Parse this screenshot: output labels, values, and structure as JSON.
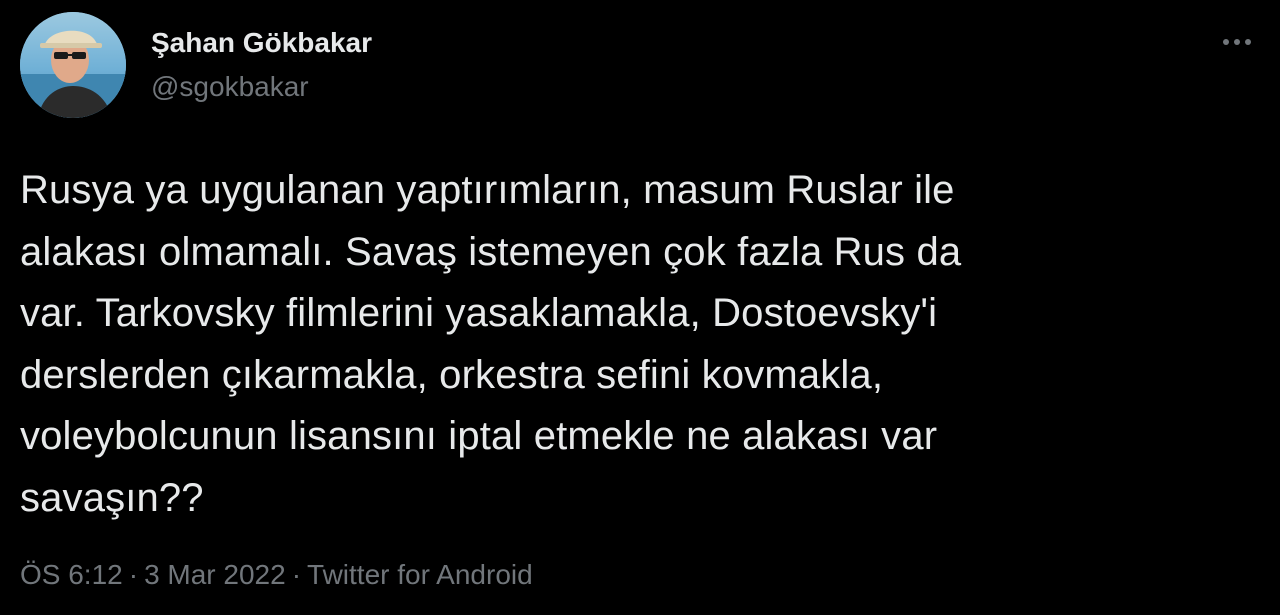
{
  "author": {
    "name": "Şahan Gökbakar",
    "handle": "@sgokbakar",
    "avatar_icon": "profile-photo"
  },
  "more_icon": "more-horizontal-icon",
  "tweet": {
    "lines": [
      "Rusya ya uygulanan yaptırımların, masum Ruslar ile",
      "alakası olmamalı. Savaş istemeyen çok fazla Rus da",
      "var. Tarkovsky filmlerini yasaklamakla, Dostoevsky'i",
      "derslerden çıkarmakla, orkestra sefini kovmakla,",
      "voleybolcunun lisansını iptal etmekle ne alakası var",
      "savaşın??"
    ]
  },
  "meta": {
    "time": "ÖS 6:12",
    "separator": "·",
    "date": "3 Mar 2022",
    "source": "Twitter for Android"
  },
  "colors": {
    "background": "#000000",
    "primary_text": "#e7e9ea",
    "secondary_text": "#71767b"
  }
}
